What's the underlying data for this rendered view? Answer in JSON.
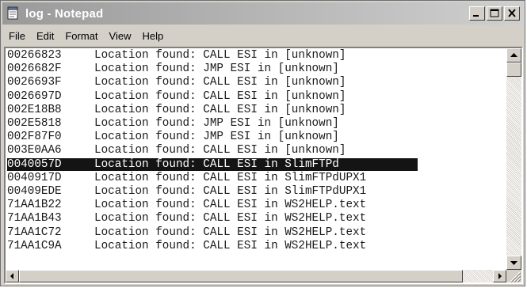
{
  "window": {
    "title": "log - Notepad"
  },
  "menu": {
    "items": [
      "File",
      "Edit",
      "Format",
      "View",
      "Help"
    ]
  },
  "document": {
    "lines": [
      {
        "address": "00266823",
        "message": "Location found: CALL ESI in [unknown]",
        "selected": false
      },
      {
        "address": "0026682F",
        "message": "Location found: JMP ESI in [unknown]",
        "selected": false
      },
      {
        "address": "0026693F",
        "message": "Location found: CALL ESI in [unknown]",
        "selected": false
      },
      {
        "address": "0026697D",
        "message": "Location found: CALL ESI in [unknown]",
        "selected": false
      },
      {
        "address": "002E18B8",
        "message": "Location found: CALL ESI in [unknown]",
        "selected": false
      },
      {
        "address": "002E5818",
        "message": "Location found: JMP ESI in [unknown]",
        "selected": false
      },
      {
        "address": "002F87F0",
        "message": "Location found: JMP ESI in [unknown]",
        "selected": false
      },
      {
        "address": "003E0AA6",
        "message": "Location found: CALL ESI in [unknown]",
        "selected": false
      },
      {
        "address": "0040057D",
        "message": "Location found: CALL ESI in SlimFTPd",
        "selected": true
      },
      {
        "address": "0040917D",
        "message": "Location found: CALL ESI in SlimFTPdUPX1",
        "selected": false
      },
      {
        "address": "00409EDE",
        "message": "Location found: CALL ESI in SlimFTPdUPX1",
        "selected": false
      },
      {
        "address": "71AA1B22",
        "message": "Location found: CALL ESI in WS2HELP.text",
        "selected": false
      },
      {
        "address": "71AA1B43",
        "message": "Location found: CALL ESI in WS2HELP.text",
        "selected": false
      },
      {
        "address": "71AA1C72",
        "message": "Location found: CALL ESI in WS2HELP.text",
        "selected": false
      },
      {
        "address": "71AA1C9A",
        "message": "Location found: CALL ESI in WS2HELP.text",
        "selected": false
      }
    ]
  },
  "icons": {
    "app": "notepad-icon",
    "minimize": "minimize-icon",
    "maximize": "maximize-icon",
    "close": "close-icon",
    "scroll_up": "arrow-up-icon",
    "scroll_down": "arrow-down-icon",
    "scroll_left": "arrow-left-icon",
    "scroll_right": "arrow-right-icon",
    "size_grip": "size-grip-icon"
  },
  "colors": {
    "titlebar": "#9a9a9a",
    "selection": "#141414",
    "window_face": "#d4d0c8"
  }
}
